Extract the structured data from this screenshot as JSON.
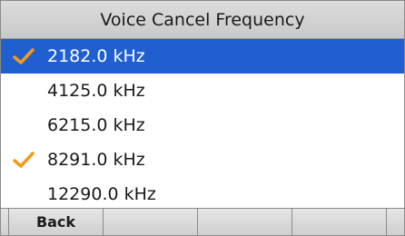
{
  "title": "Voice Cancel Frequency",
  "frequencies": [
    {
      "label": "2182.0 kHz",
      "checked": true,
      "selected": true
    },
    {
      "label": "4125.0 kHz",
      "checked": false,
      "selected": false
    },
    {
      "label": "6215.0 kHz",
      "checked": false,
      "selected": false
    },
    {
      "label": "8291.0 kHz",
      "checked": true,
      "selected": false
    },
    {
      "label": "12290.0 kHz",
      "checked": false,
      "selected": false
    }
  ],
  "softkeys": [
    "Back",
    "",
    "",
    ""
  ],
  "colors": {
    "selection": "#1f5fcf",
    "check": "#f29a1a"
  },
  "icons": {
    "check": "checkmark-icon"
  }
}
